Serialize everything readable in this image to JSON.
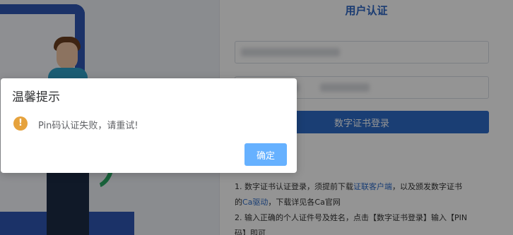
{
  "panel": {
    "title": "用户认证",
    "login_button": "数字证书登录",
    "notes": {
      "line1_prefix": "1. 数字证书认证登录，须提前下载",
      "line1_link": "证联客户端",
      "line1_suffix": "，以及颁发数字证书",
      "line2_prefix": "的",
      "line2_link": "Ca驱动",
      "line2_suffix": "，下载详见各Ca官网",
      "line3": "2. 输入正确的个人证件号及姓名，点击【数字证书登录】输入【PIN",
      "line4": "码】即可"
    }
  },
  "dialog": {
    "title": "温馨提示",
    "icon": "warning-icon",
    "icon_glyph": "!",
    "message": "Pin码认证失败，请重试!",
    "confirm_label": "确定"
  },
  "colors": {
    "accent": "#2d6bc8",
    "warning": "#e6a23c",
    "confirm_button": "#66b1ff"
  }
}
